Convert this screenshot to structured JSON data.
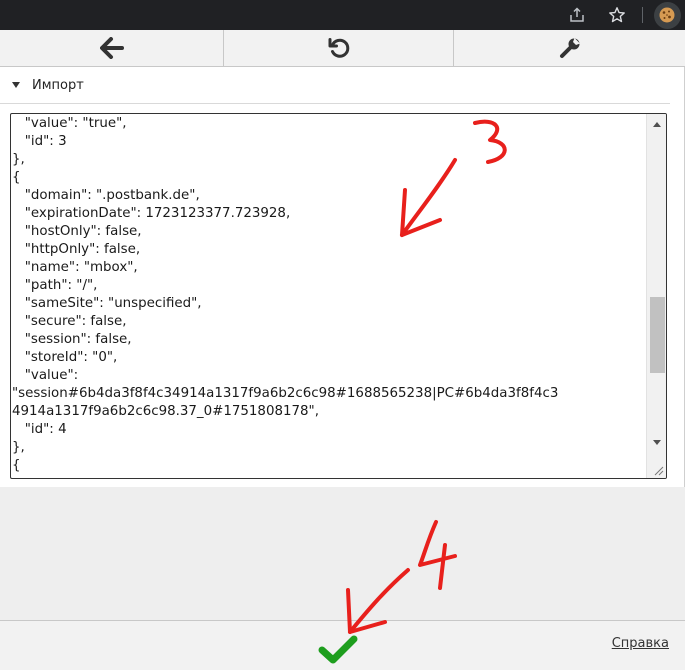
{
  "browser": {
    "share_icon": "share-icon",
    "star_icon": "bookmark-star-icon",
    "extension_icon": "cookie-extension-icon"
  },
  "toolbar": {
    "back_icon": "arrow-left-icon",
    "reload_icon": "reload-icon",
    "tools_icon": "wrench-icon"
  },
  "section": {
    "title": "Импорт"
  },
  "textarea": {
    "lines": [
      "   \"value\": \"true\",",
      "   \"id\": 3",
      "},",
      "{",
      "   \"domain\": \".postbank.de\",",
      "   \"expirationDate\": 1723123377.723928,",
      "   \"hostOnly\": false,",
      "   \"httpOnly\": false,",
      "   \"name\": \"mbox\",",
      "   \"path\": \"/\",",
      "   \"sameSite\": \"unspecified\",",
      "   \"secure\": false,",
      "   \"session\": false,",
      "   \"storeId\": \"0\",",
      "   \"value\":",
      "\"session#6b4da3f8f4c34914a1317f9a6b2c6c98#1688565238|PC#6b4da3f8f4c3",
      "4914a1317f9a6b2c6c98.37_0#1751808178\",",
      "   \"id\": 4",
      "},",
      "{"
    ]
  },
  "annotations": {
    "step3": "3",
    "step4": "4",
    "color": "#e8201c"
  },
  "footer": {
    "ok_icon": "checkmark-icon",
    "ok_color": "#1e9e1e",
    "help_label": "Справка"
  }
}
